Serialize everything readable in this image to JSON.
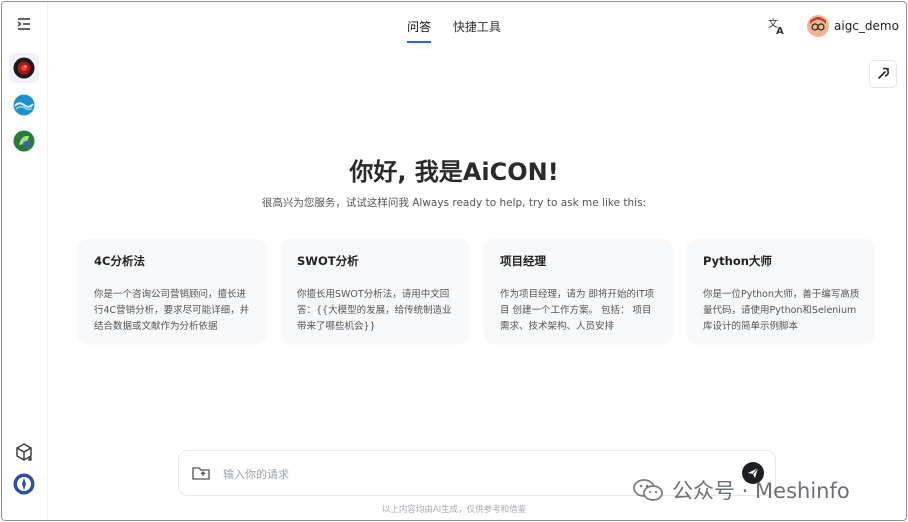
{
  "header": {
    "tabs": [
      {
        "label": "问答",
        "active": true
      },
      {
        "label": "快捷工具",
        "active": false
      }
    ],
    "language_icon": "translate-icon",
    "username": "aigc_demo"
  },
  "sidebar": {
    "toggle_icon": "sidebar-toggle-icon",
    "models": [
      {
        "icon": "red-orb-model-icon",
        "active": true
      },
      {
        "icon": "blue-wave-model-icon",
        "active": false
      },
      {
        "icon": "green-leaf-model-icon",
        "active": false
      }
    ],
    "bottom_icons": [
      "cube-icon",
      "profile-badge-icon"
    ]
  },
  "hero": {
    "title": "你好, 我是AiCON!",
    "subtitle": "很高兴为您服务，试试这样问我 Always ready to help, try to ask me like this:"
  },
  "cards": [
    {
      "title": "4C分析法",
      "desc": "你是一个咨询公司营销顾问，擅长进行4C营销分析，要求尽可能详细，并结合数据或文献作为分析依据"
    },
    {
      "title": "SWOT分析",
      "desc": "你擅长用SWOT分析法，请用中文回答：{{大模型的发展，给传统制造业带来了哪些机会}}"
    },
    {
      "title": "项目经理",
      "desc": "作为项目经理，请为 即将开始的IT项目 创建一个工作方案。 包括： 项目需求、技术架构、人员安排"
    },
    {
      "title": "Python大师",
      "desc": "你是一位Python大师，善于编写高质量代码，请使用Python和Selenium库设计的简单示例脚本"
    }
  ],
  "input": {
    "placeholder": "输入你的请求"
  },
  "footer": {
    "note": "以上内容均由AI生成，仅供参考和借鉴"
  },
  "watermark": {
    "text": "公众号 · Meshinfo"
  },
  "colors": {
    "accent": "#2b63d9",
    "send_button": "#1e1f24",
    "card_bg": "#f7f8fa"
  }
}
